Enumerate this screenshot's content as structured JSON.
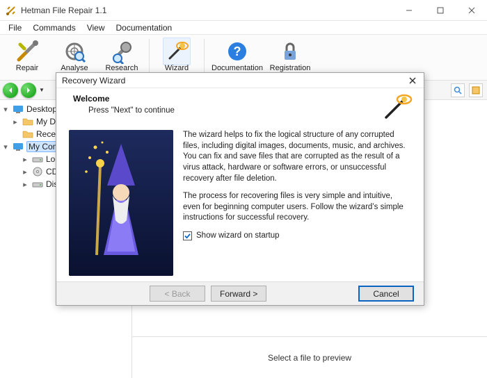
{
  "window": {
    "title": "Hetman File Repair 1.1"
  },
  "menu": {
    "items": [
      "File",
      "Commands",
      "View",
      "Documentation"
    ]
  },
  "toolbar": {
    "repair": "Repair",
    "analyse": "Analyse",
    "research": "Research",
    "wizard": "Wizard",
    "documentation": "Documentation",
    "registration": "Registration"
  },
  "tree": {
    "desktop": "Desktop",
    "mydocs": "My Documents",
    "recent": "Recent Documents",
    "mycomp": "My Computer",
    "local": "Local Disk (C:)",
    "cd": "CD Drive (D:)",
    "diske": "Disk (E:)"
  },
  "preview": {
    "placeholder": "Select a file to preview"
  },
  "modal": {
    "title": "Recovery Wizard",
    "welcome_title": "Welcome",
    "welcome_sub": "Press \"Next\" to continue",
    "para1": "The wizard helps to fix the logical structure of any corrupted files, including digital images, documents, music, and archives. You can fix and save files that are corrupted as the result of a virus attack, hardware or software errors, or unsuccessful recovery after file deletion.",
    "para2": "The process for recovering files is very simple and intuitive, even for beginning computer users. Follow the wizard’s simple instructions for successful recovery.",
    "checkbox_label": "Show wizard on startup",
    "checkbox_checked": true,
    "back": "< Back",
    "forward": "Forward >",
    "cancel": "Cancel"
  }
}
